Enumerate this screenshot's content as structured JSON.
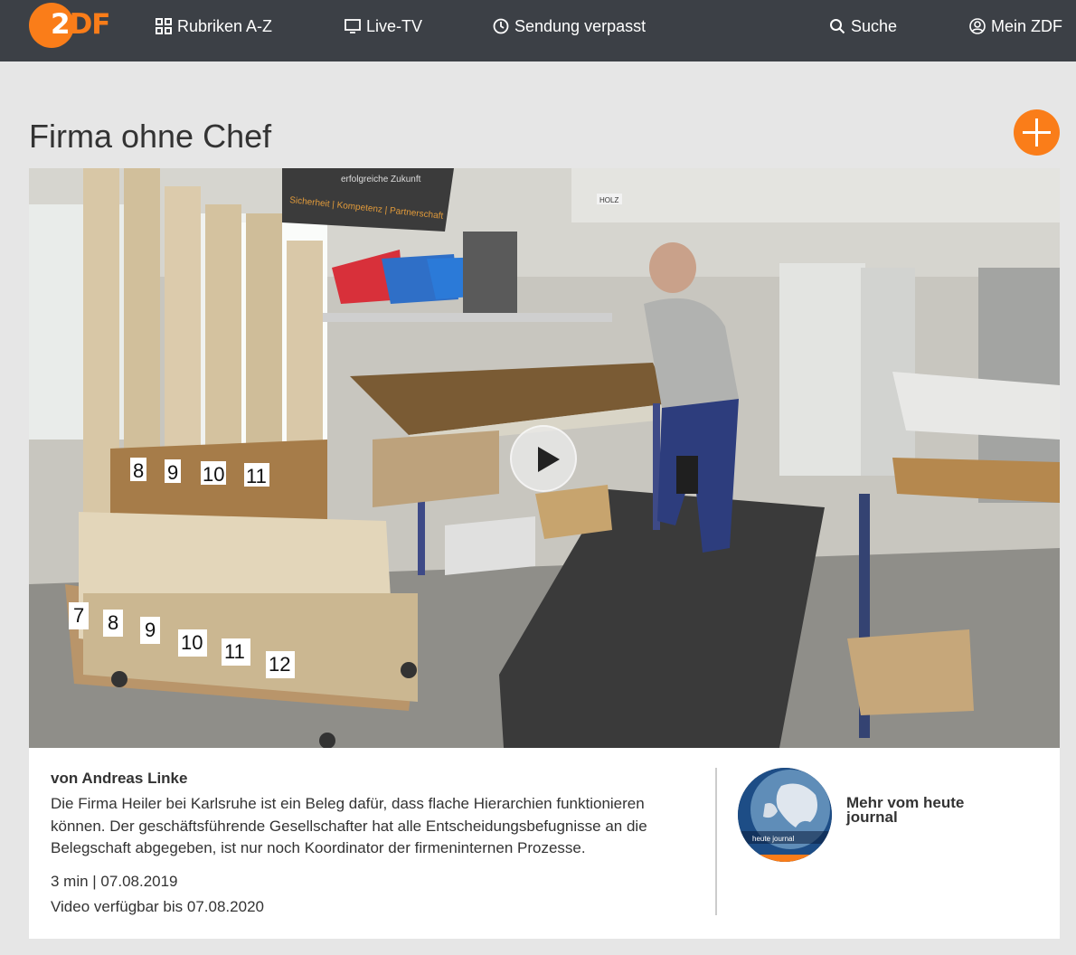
{
  "header": {
    "logo": "ZDF",
    "nav": {
      "rubriken": "Rubriken A-Z",
      "live": "Live-TV",
      "missed": "Sendung verpasst",
      "search": "Suche",
      "account": "Mein ZDF"
    }
  },
  "main": {
    "title": "Firma ohne Chef",
    "video": {
      "play_icon": "play-icon",
      "wall_sign_1": "erfolgreiche Zukunft",
      "wall_sign_2": "Sicherheit | Kompetenz | Partnerschaft",
      "box_label": "HOLZ",
      "tube_numbers_top": [
        "8",
        "9",
        "10",
        "11"
      ],
      "tube_numbers_bottom": [
        "7",
        "8",
        "9",
        "10",
        "11",
        "12"
      ]
    },
    "info": {
      "author": "von Andreas Linke",
      "description": "Die Firma Heiler bei Karlsruhe ist ein Beleg dafür, dass flache Hierarchien funktionieren können. Der geschäftsführende Gesellschafter hat alle Entscheidungsbefugnisse an die Belegschaft abgegeben, ist nur noch Koordinator der firmeninternen Prozesse.",
      "meta": "3 min | 07.08.2019",
      "available": "Video verfügbar bis 07.08.2020"
    },
    "more": {
      "label": "Mehr vom heute journal",
      "thumb_text": "heute journal"
    }
  },
  "colors": {
    "accent": "#fa7d19",
    "header_bg": "#3c4046",
    "page_bg": "#e6e6e6"
  }
}
